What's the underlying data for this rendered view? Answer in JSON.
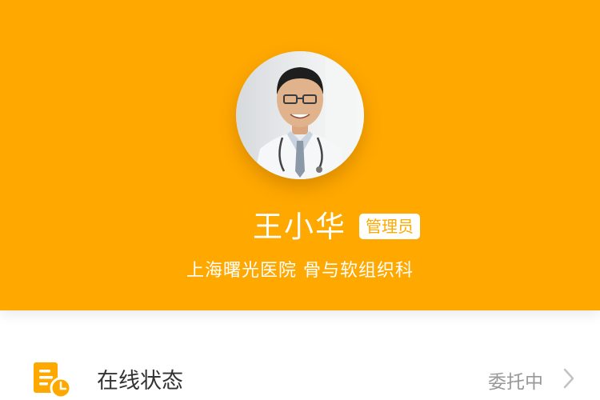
{
  "profile": {
    "name": "王小华",
    "role_badge": "管理员",
    "affiliation": "上海曙光医院  骨与软组织科",
    "avatar_icon": "doctor-avatar-photo"
  },
  "menu": {
    "online_status": {
      "label": "在线状态",
      "value": "委托中",
      "icon": "status-document-clock-icon"
    }
  },
  "colors": {
    "header": "#FFA800",
    "text_dark": "#333333",
    "text_muted": "#999999"
  }
}
